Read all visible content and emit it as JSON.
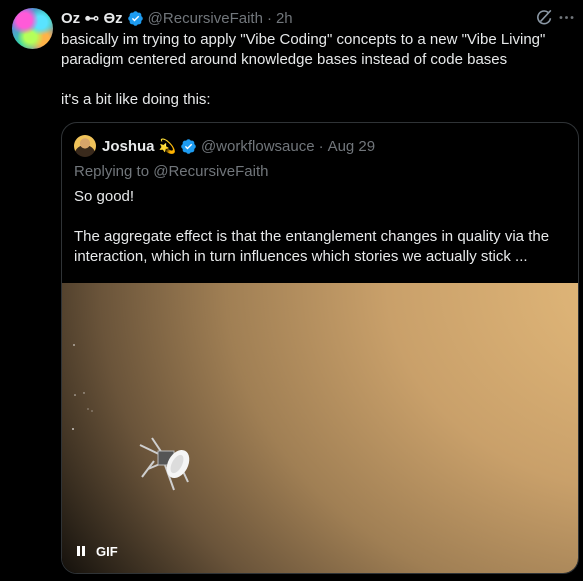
{
  "tweet": {
    "author_name": "Oz ⊷ Ɵz",
    "author_handle": "@RecursiveFaith",
    "separator": "·",
    "time": "2h",
    "verified": true,
    "text_line1": "basically im trying to apply \"Vibe Coding\" concepts to a new \"Vibe Living\"",
    "text_line2": "paradigm centered around knowledge bases instead of code bases",
    "text_line3": "it's a bit like doing this:"
  },
  "quoted_tweet": {
    "author_name": "Joshua",
    "author_emoji": "💫",
    "author_handle": "@workflowsauce",
    "separator": "·",
    "date": "Aug 29",
    "replying_to": "Replying to @RecursiveFaith",
    "text_line1": "So good!",
    "text_line2": "The aggregate effect is that the entanglement changes in quality via the",
    "text_line3": "interaction, which in turn influences which stories we actually stick ...",
    "media": {
      "type": "GIF",
      "badge_label": "GIF",
      "pause_icon": "pause-icon"
    }
  },
  "icons": {
    "verified": "verified-badge-icon",
    "grok": "grok-icon",
    "more": "more-icon"
  },
  "colors": {
    "background": "#000000",
    "text": "#e7e9ea",
    "secondary": "#71767b",
    "verified": "#1d9bf0",
    "border": "#2f3336"
  }
}
